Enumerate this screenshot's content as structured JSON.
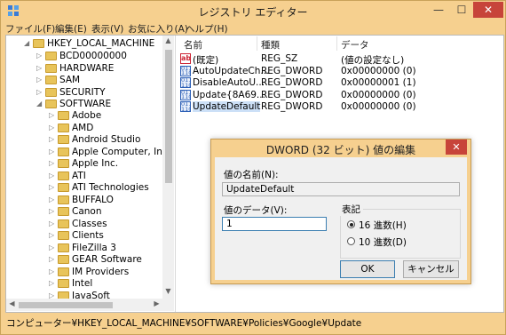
{
  "window": {
    "title": "レジストリ エディター",
    "min_glyph": "—",
    "max_glyph": "☐",
    "close_glyph": "✕"
  },
  "menu": [
    "ファイル(F)",
    "編集(E)",
    "表示(V)",
    "お気に入り(A)",
    "ヘルプ(H)"
  ],
  "tree": {
    "root": {
      "label": "HKEY_LOCAL_MACHINE",
      "expanded": true
    },
    "hive_items": [
      {
        "label": "BCD00000000"
      },
      {
        "label": "HARDWARE"
      },
      {
        "label": "SAM"
      },
      {
        "label": "SECURITY"
      },
      {
        "label": "SOFTWARE"
      }
    ],
    "software_items": [
      {
        "label": "Adobe"
      },
      {
        "label": "AMD"
      },
      {
        "label": "Android Studio"
      },
      {
        "label": "Apple Computer, Inc."
      },
      {
        "label": "Apple Inc."
      },
      {
        "label": "ATI"
      },
      {
        "label": "ATI Technologies"
      },
      {
        "label": "BUFFALO"
      },
      {
        "label": "Canon"
      },
      {
        "label": "Classes"
      },
      {
        "label": "Clients"
      },
      {
        "label": "FileZilla 3"
      },
      {
        "label": "GEAR Software"
      },
      {
        "label": "IM Providers"
      },
      {
        "label": "Intel"
      },
      {
        "label": "JavaSoft"
      }
    ]
  },
  "list": {
    "headers": {
      "name": "名前",
      "type": "種類",
      "data": "データ"
    },
    "rows": [
      {
        "icon": "string-value-icon",
        "icon_glyph": "ab",
        "name": "(既定)",
        "type": "REG_SZ",
        "data": "(値の設定なし)"
      },
      {
        "icon": "binary-value-icon",
        "icon_glyph": "011\n110",
        "name": "AutoUpdateCh...",
        "type": "REG_DWORD",
        "data": "0x00000000 (0)"
      },
      {
        "icon": "binary-value-icon",
        "icon_glyph": "011\n110",
        "name": "DisableAutoU...",
        "type": "REG_DWORD",
        "data": "0x00000001 (1)"
      },
      {
        "icon": "binary-value-icon",
        "icon_glyph": "011\n110",
        "name": "Update{8A69...",
        "type": "REG_DWORD",
        "data": "0x00000000 (0)"
      },
      {
        "icon": "binary-value-icon",
        "icon_glyph": "011\n110",
        "name": "UpdateDefault",
        "type": "REG_DWORD",
        "data": "0x00000000 (0)"
      }
    ]
  },
  "status": {
    "path": "コンピューター¥HKEY_LOCAL_MACHINE¥SOFTWARE¥Policies¥Google¥Update"
  },
  "dialog": {
    "title": "DWORD (32 ビット) 値の編集",
    "close_glyph": "✕",
    "name_label": "値の名前(N):",
    "name_value": "UpdateDefault",
    "data_label": "値のデータ(V):",
    "data_value": "1",
    "base_label": "表記",
    "radio_hex": "16 進数(H)",
    "radio_dec": "10 進数(D)",
    "radio_selected": "hex",
    "ok": "OK",
    "cancel": "キャンセル"
  },
  "colors": {
    "frame": "#f6d08f",
    "close": "#c7443a",
    "folder": "#e8c45a",
    "selected_row": "#cce0f7"
  }
}
